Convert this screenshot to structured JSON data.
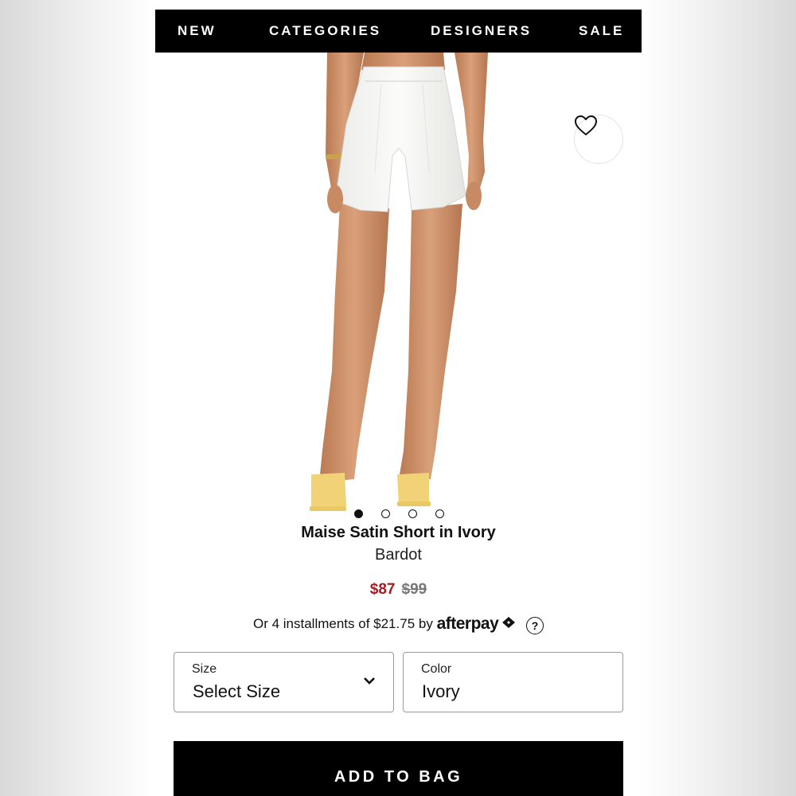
{
  "nav": {
    "items": [
      {
        "label": "NEW"
      },
      {
        "label": "CATEGORIES"
      },
      {
        "label": "DESIGNERS"
      },
      {
        "label": "SALE"
      }
    ]
  },
  "gallery": {
    "image_count": 4,
    "active_index": 0,
    "favorite_icon": "heart-icon"
  },
  "product": {
    "title": "Maise Satin Short in Ivory",
    "brand": "Bardot",
    "sale_price": "$87",
    "original_price": "$99"
  },
  "installments": {
    "text": "Or 4 installments of $21.75 by",
    "provider": "afterpay",
    "help_label": "?"
  },
  "options": {
    "size": {
      "label": "Size",
      "value": "Select Size"
    },
    "color": {
      "label": "Color",
      "value": "Ivory"
    }
  },
  "cta": {
    "add_to_bag": "ADD TO BAG"
  },
  "colors": {
    "nav_bg": "#000000",
    "sale_price": "#a11d22",
    "original_price": "#777777",
    "button_bg": "#000000"
  }
}
